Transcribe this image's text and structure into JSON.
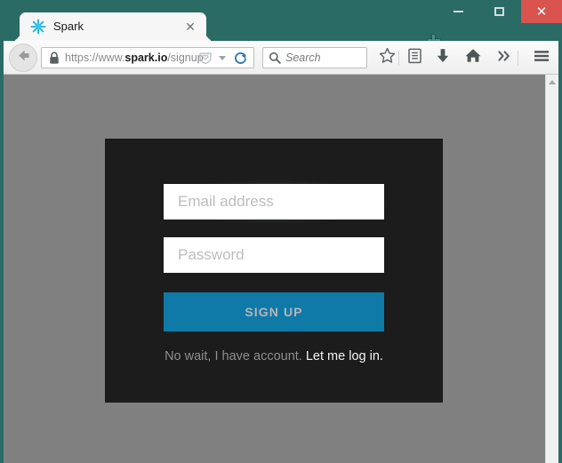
{
  "window": {
    "chrome_color": "#2a6b66",
    "controls": {
      "minimize_label": "—",
      "maximize_label": "□",
      "close_label": "✕"
    }
  },
  "tabs": {
    "active": {
      "title": "Spark",
      "favicon": "spark-asterisk-icon",
      "favicon_color": "#2bb8e8",
      "close_label": "✕"
    },
    "new_tab_label": "+"
  },
  "toolbar": {
    "back_icon": "back-arrow-icon",
    "url": {
      "prefix": "https://www.",
      "domain": "spark.io",
      "path": "/signup",
      "lock_icon": "lock-icon",
      "reader_icon": "reader-mode-icon",
      "reload_icon": "reload-icon"
    },
    "search": {
      "placeholder": "Search",
      "icon": "search-icon"
    },
    "buttons": [
      {
        "name": "bookmark-star-button",
        "icon": "star-icon"
      },
      {
        "name": "reading-list-button",
        "icon": "clipboard-icon"
      },
      {
        "name": "downloads-button",
        "icon": "download-arrow-icon"
      },
      {
        "name": "home-button",
        "icon": "home-icon"
      },
      {
        "name": "overflow-button",
        "icon": "double-chevron-right-icon"
      },
      {
        "name": "menu-button",
        "icon": "hamburger-menu-icon"
      }
    ]
  },
  "page": {
    "background_color": "#808080",
    "card": {
      "background_color": "#1c1c1c",
      "email": {
        "placeholder": "Email address",
        "value": "",
        "focused": true
      },
      "password": {
        "placeholder": "Password",
        "value": "",
        "focused": false
      },
      "submit": {
        "label": "SIGN UP",
        "color": "#0f79a8",
        "text_color": "#b6b6b6"
      },
      "login_prompt": {
        "text": "No wait, I have account.",
        "link_text": "Let me log in."
      }
    }
  },
  "scrollbar": {
    "up_arrow_icon": "chevron-up-icon",
    "position": "top"
  }
}
